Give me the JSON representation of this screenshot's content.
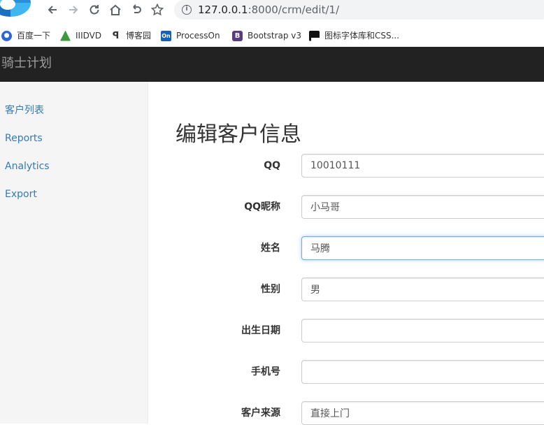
{
  "browser": {
    "url_host": "127.0.0.1",
    "url_rest": ":8000/crm/edit/1/"
  },
  "bookmarks": [
    {
      "label": "百度一下",
      "icon": "baidu-paw-icon",
      "color": "#2b65d9"
    },
    {
      "label": "IIIDVD",
      "icon": "iiidvd-icon",
      "color": "#3c9a3c"
    },
    {
      "label": "博客园",
      "icon": "cnblogs-icon",
      "color": "#333333"
    },
    {
      "label": "ProcessOn",
      "icon": "processon-icon",
      "color": "#1a5fb4"
    },
    {
      "label": "Bootstrap v3",
      "icon": "bootstrap-icon",
      "color": "#563d7c"
    },
    {
      "label": "图标字体库和CSS...",
      "icon": "flag-icon",
      "color": "#111111"
    }
  ],
  "navbar": {
    "brand": "骑士计划"
  },
  "sidebar": {
    "items": [
      {
        "label": "客户列表"
      },
      {
        "label": "Reports"
      },
      {
        "label": "Analytics"
      },
      {
        "label": "Export"
      }
    ]
  },
  "form": {
    "title": "编辑客户信息",
    "fields": [
      {
        "label": "QQ",
        "value": "10010111"
      },
      {
        "label": "QQ昵称",
        "value": "小马哥"
      },
      {
        "label": "姓名",
        "value": "马腾"
      },
      {
        "label": "性别",
        "value": "男"
      },
      {
        "label": "出生日期",
        "value": ""
      },
      {
        "label": "手机号",
        "value": ""
      },
      {
        "label": "客户来源",
        "value": "直接上门"
      }
    ]
  }
}
